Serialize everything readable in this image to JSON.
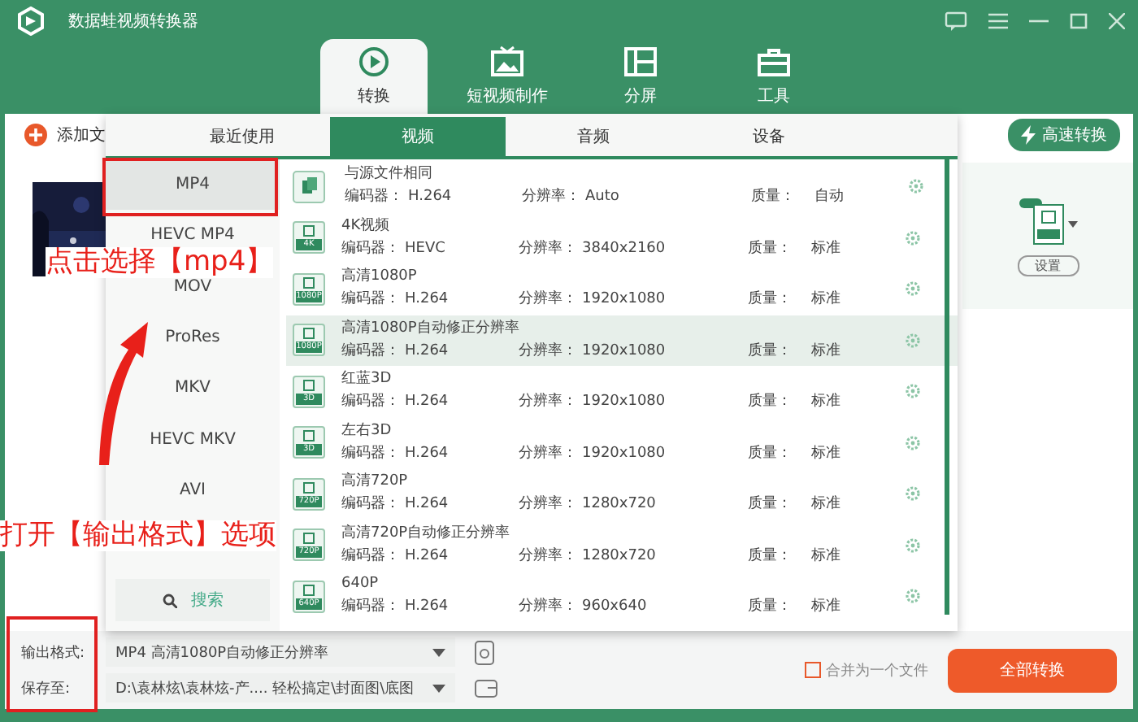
{
  "window": {
    "title": "数据蛙视频转换器"
  },
  "nav_tabs": [
    {
      "label": "转换",
      "kind": "convert",
      "selected": true
    },
    {
      "label": "短视频制作",
      "kind": "video",
      "selected": false
    },
    {
      "label": "分屏",
      "kind": "split",
      "selected": false
    },
    {
      "label": "工具",
      "kind": "tools",
      "selected": false
    }
  ],
  "toolbar": {
    "add_file": "添加文",
    "fast_convert": "高速转换"
  },
  "format_panel": {
    "tabs": [
      {
        "label": "最近使用",
        "selected": false
      },
      {
        "label": "视频",
        "selected": true
      },
      {
        "label": "音频",
        "selected": false
      },
      {
        "label": "设备",
        "selected": false
      }
    ],
    "formats": [
      {
        "label": "MP4",
        "selected": true
      },
      {
        "label": "HEVC MP4",
        "selected": false
      },
      {
        "label": "MOV",
        "selected": false
      },
      {
        "label": "ProRes",
        "selected": false
      },
      {
        "label": "MKV",
        "selected": false
      },
      {
        "label": "HEVC MKV",
        "selected": false
      },
      {
        "label": "AVI",
        "selected": false
      }
    ],
    "search": "搜索",
    "presets": [
      {
        "name": "与源文件相同",
        "kind": "copy",
        "encoder_label": "编码器：",
        "encoder": "H.264",
        "resolution_label": "分辨率：",
        "resolution": "Auto",
        "quality_label": "质量：",
        "quality": "自动",
        "selected": false
      },
      {
        "name": "4K视频",
        "kind": "file",
        "badge": "4K",
        "encoder_label": "编码器：",
        "encoder": "HEVC",
        "resolution_label": "分辨率：",
        "resolution": "3840x2160",
        "quality_label": "质量：",
        "quality": "标准",
        "selected": false
      },
      {
        "name": "高清1080P",
        "kind": "file",
        "badge": "1080P",
        "encoder_label": "编码器：",
        "encoder": "H.264",
        "resolution_label": "分辨率：",
        "resolution": "1920x1080",
        "quality_label": "质量：",
        "quality": "标准",
        "selected": false
      },
      {
        "name": "高清1080P自动修正分辨率",
        "kind": "file",
        "badge": "1080P",
        "encoder_label": "编码器：",
        "encoder": "H.264",
        "resolution_label": "分辨率：",
        "resolution": "1920x1080",
        "quality_label": "质量：",
        "quality": "标准",
        "selected": true
      },
      {
        "name": "红蓝3D",
        "kind": "file",
        "badge": "3D",
        "encoder_label": "编码器：",
        "encoder": "H.264",
        "resolution_label": "分辨率：",
        "resolution": "1920x1080",
        "quality_label": "质量：",
        "quality": "标准",
        "selected": false
      },
      {
        "name": "左右3D",
        "kind": "file",
        "badge": "3D",
        "encoder_label": "编码器：",
        "encoder": "H.264",
        "resolution_label": "分辨率：",
        "resolution": "1920x1080",
        "quality_label": "质量：",
        "quality": "标准",
        "selected": false
      },
      {
        "name": "高清720P",
        "kind": "file",
        "badge": "720P",
        "encoder_label": "编码器：",
        "encoder": "H.264",
        "resolution_label": "分辨率：",
        "resolution": "1280x720",
        "quality_label": "质量：",
        "quality": "标准",
        "selected": false
      },
      {
        "name": "高清720P自动修正分辨率",
        "kind": "file",
        "badge": "720P",
        "encoder_label": "编码器：",
        "encoder": "H.264",
        "resolution_label": "分辨率：",
        "resolution": "1280x720",
        "quality_label": "质量：",
        "quality": "标准",
        "selected": false
      },
      {
        "name": "640P",
        "kind": "file",
        "badge": "640P",
        "encoder_label": "编码器：",
        "encoder": "H.264",
        "resolution_label": "分辨率：",
        "resolution": "960x640",
        "quality_label": "质量：",
        "quality": "标准",
        "selected": false
      }
    ]
  },
  "output_card": {
    "settings": "设置"
  },
  "footer": {
    "output_format_label": "输出格式:",
    "output_format": "MP4 高清1080P自动修正分辨率",
    "save_to_label": "保存至:",
    "save_to": "D:\\袁林炫\\袁林炫-产.... 轻松搞定\\封面图\\底图",
    "merge": {
      "label": "合并为一个文件",
      "checked": false
    },
    "convert_all": "全部转换"
  },
  "annotations": [
    {
      "kind": "pick",
      "text": "点击选择【mp4】"
    },
    {
      "kind": "open",
      "text": "打开【输出格式】选项"
    }
  ]
}
